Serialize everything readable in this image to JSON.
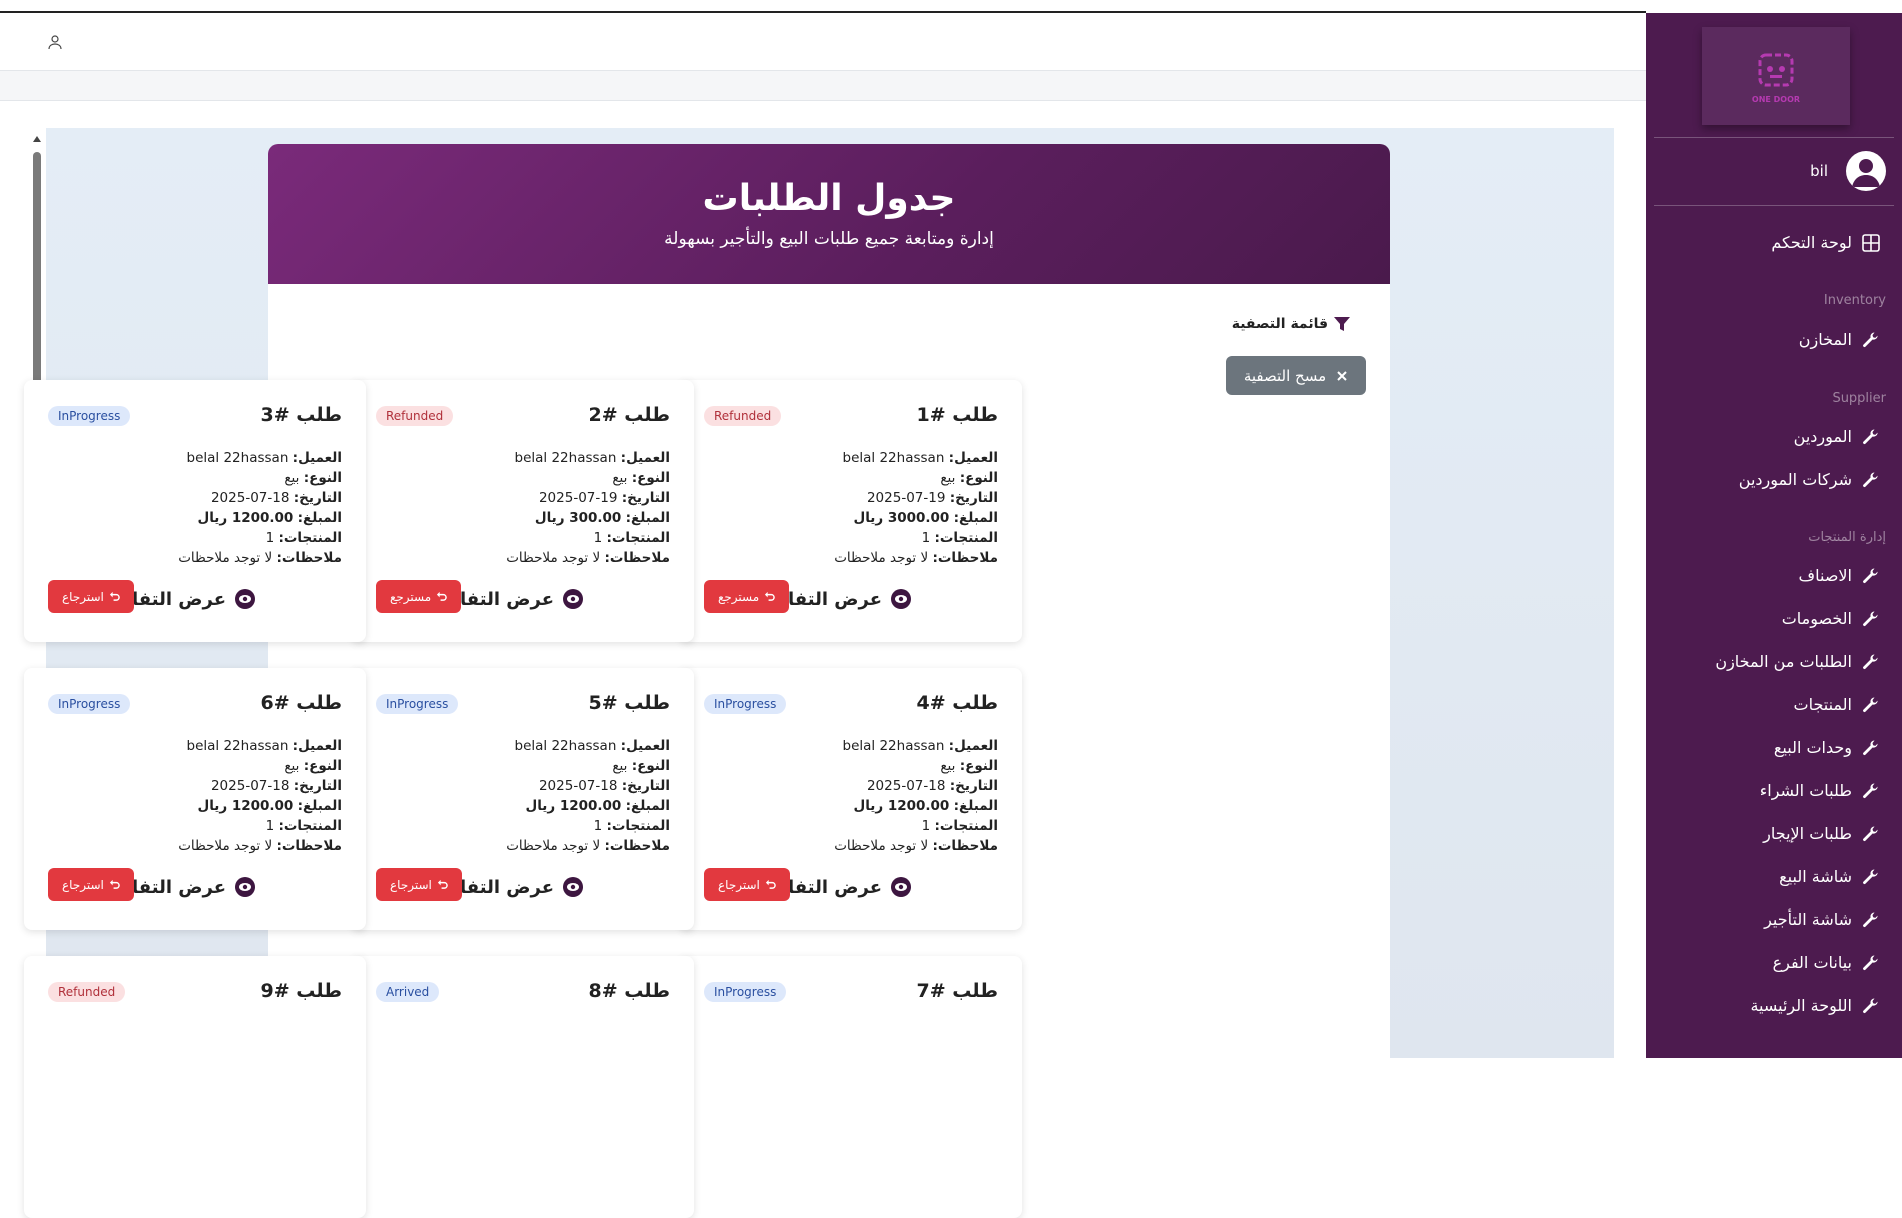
{
  "sidebar": {
    "user_name": "bil",
    "logo_text": "ONE DOOR",
    "dashboard": "لوحة التحكم",
    "sections": {
      "inventory": "Inventory",
      "supplier": "Supplier",
      "products": "إدارة المنتجات"
    },
    "items": {
      "warehouses": "المخازن",
      "suppliers": "الموردين",
      "supplier_companies": "شركات الموردين",
      "categories": "الاصناف",
      "discounts": "الخصومات",
      "warehouse_requests": "الطلبات من المخازن",
      "products": "المنتجات",
      "sale_units": "وحدات البيع",
      "purchase_orders": "طلبات الشراء",
      "rental_orders": "طلبات الإيجار",
      "sales_screen": "شاشة البيع",
      "rental_screen": "شاشة التأجير",
      "branch_data": "بيانات الفرع",
      "main_board": "اللوحة الرئيسية"
    }
  },
  "header": {
    "title": "جدول الطلبات",
    "subtitle": "إدارة ومتابعة جميع طلبات البيع والتأجير بسهولة"
  },
  "filters": {
    "title": "قائمة التصفية",
    "clear_label": "مسح التصفية"
  },
  "labels": {
    "client": "العميل:",
    "type": "النوع:",
    "date": "التاريخ:",
    "amount": "المبلغ:",
    "products": "المنتجات:",
    "notes": "ملاحظات:",
    "details": "عرض التفاصيل"
  },
  "orders": [
    {
      "title": "طلب #1",
      "status": "Refunded",
      "client": "belal 22hassan",
      "type": "بيع",
      "date": "19-07-2025",
      "amount": "3000.00 ريال",
      "products": "1",
      "notes": "لا توجد ملاحظات",
      "action": "مسترجع"
    },
    {
      "title": "طلب #2",
      "status": "Refunded",
      "client": "belal 22hassan",
      "type": "بيع",
      "date": "19-07-2025",
      "amount": "300.00 ريال",
      "products": "1",
      "notes": "لا توجد ملاحظات",
      "action": "مسترجع"
    },
    {
      "title": "طلب #3",
      "status": "InProgress",
      "client": "belal 22hassan",
      "type": "بيع",
      "date": "18-07-2025",
      "amount": "1200.00 ريال",
      "products": "1",
      "notes": "لا توجد ملاحظات",
      "action": "استرجاع"
    },
    {
      "title": "طلب #4",
      "status": "InProgress",
      "client": "belal 22hassan",
      "type": "بيع",
      "date": "18-07-2025",
      "amount": "1200.00 ريال",
      "products": "1",
      "notes": "لا توجد ملاحظات",
      "action": "استرجاع"
    },
    {
      "title": "طلب #5",
      "status": "InProgress",
      "client": "belal 22hassan",
      "type": "بيع",
      "date": "18-07-2025",
      "amount": "1200.00 ريال",
      "products": "1",
      "notes": "لا توجد ملاحظات",
      "action": "استرجاع"
    },
    {
      "title": "طلب #6",
      "status": "InProgress",
      "client": "belal 22hassan",
      "type": "بيع",
      "date": "18-07-2025",
      "amount": "1200.00 ريال",
      "products": "1",
      "notes": "لا توجد ملاحظات",
      "action": "استرجاع"
    },
    {
      "title": "طلب #7",
      "status": "InProgress"
    },
    {
      "title": "طلب #8",
      "status": "Arrived"
    },
    {
      "title": "طلب #9",
      "status": "Refunded"
    }
  ]
}
